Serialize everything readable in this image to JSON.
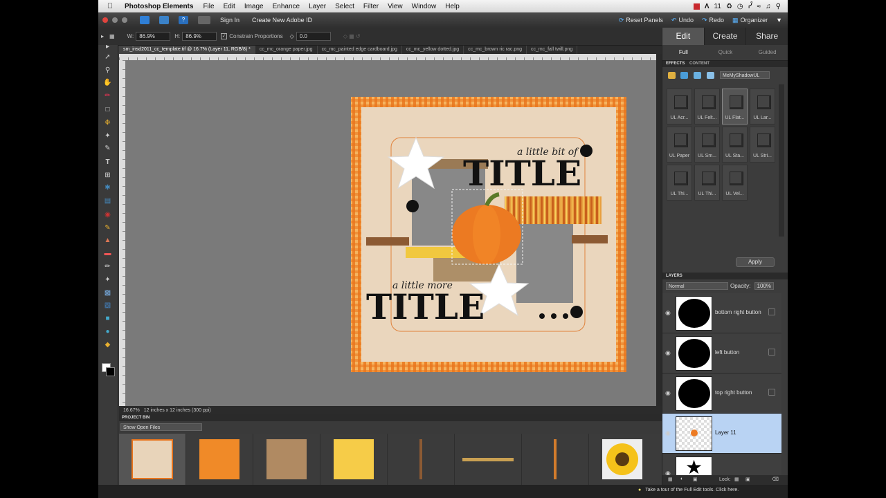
{
  "colors": {
    "accent_blue": "#5ab4ff",
    "selected_layer": "#b9d3f3",
    "canvas_gray": "#7a7a7a",
    "frame_orange": "#f08a28"
  },
  "menubar": {
    "app_name": "Photoshop Elements",
    "items": [
      "File",
      "Edit",
      "Image",
      "Enhance",
      "Layer",
      "Select",
      "Filter",
      "View",
      "Window",
      "Help"
    ],
    "status_number": "11"
  },
  "appbar": {
    "sign_in": "Sign In",
    "create_id": "Create New Adobe ID",
    "reset_panels": "Reset Panels",
    "undo": "Undo",
    "redo": "Redo",
    "organizer": "Organizer"
  },
  "options": {
    "w_label": "W:",
    "w_value": "86.9%",
    "h_label": "H:",
    "h_value": "86.9%",
    "constrain_label": "Constrain Proportions",
    "angle_value": "0.0"
  },
  "doc_tabs": [
    "sm_insd2011_cc_template.tif @ 16.7% (Layer 11, RGB/8) *",
    "cc_mc_orange paper.jpg",
    "cc_mc_painted edge cardboard.jpg",
    "cc_mc_yellow dotted.jpg",
    "cc_mc_brown ric rac.png",
    "cc_mc_fall twill.png"
  ],
  "canvas": {
    "title_top_small": "a little bit of",
    "title_top_big": "TITLE",
    "title_bottom_small": "a little more",
    "title_bottom_big": "TITLE"
  },
  "status": {
    "zoom": "16.67%",
    "doc_size": "12 inches x 12 inches (300 ppi)"
  },
  "project_bin": {
    "header": "PROJECT BIN",
    "dropdown": "Show Open Files"
  },
  "footer": {
    "tip": "Take a tour of the Full Edit tools. Click here."
  },
  "right_panel": {
    "modes": [
      "Edit",
      "Create",
      "Share"
    ],
    "sub_modes": [
      "Full",
      "Quick",
      "Guided"
    ],
    "effects_tabs": [
      "EFFECTS",
      "CONTENT"
    ],
    "effects_dropdown": "MeMyShadowUL",
    "effects": [
      "UL Acr...",
      "UL Felt...",
      "UL Flat...",
      "UL Lar...",
      "UL Paper",
      "UL Sm...",
      "UL Sta...",
      "UL Stri...",
      "UL Thi...",
      "UL Thi...",
      "UL Vel..."
    ],
    "apply": "Apply",
    "layers_header": "LAYERS",
    "blend_mode": "Normal",
    "opacity_label": "Opacity:",
    "opacity_value": "100%",
    "layers": [
      "bottom right button",
      "left button",
      "top right button",
      "Layer 11"
    ],
    "lock_label": "Lock:"
  }
}
